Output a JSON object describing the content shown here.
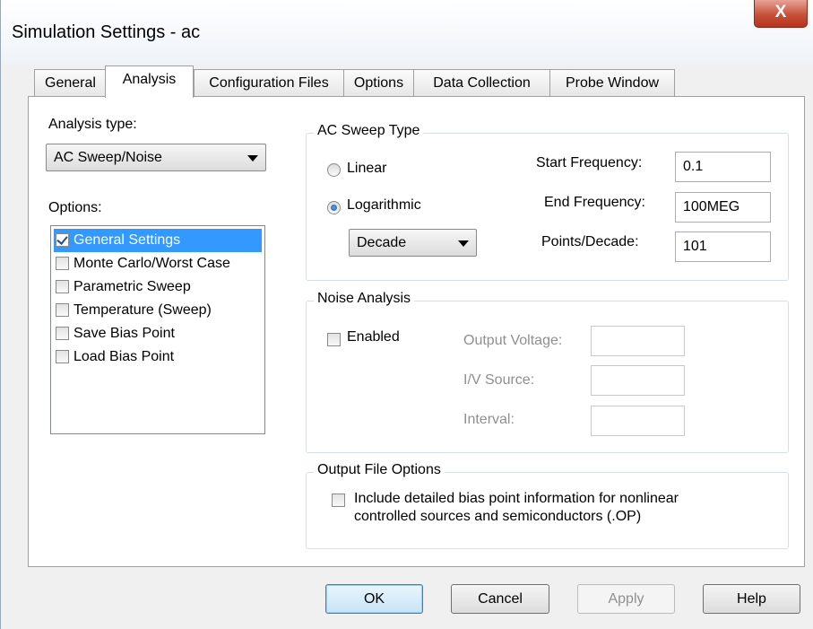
{
  "window": {
    "title": "Simulation Settings - ac",
    "close_label": "X"
  },
  "tabs": [
    {
      "label": "General",
      "active": false
    },
    {
      "label": "Analysis",
      "active": true
    },
    {
      "label": "Configuration Files",
      "active": false
    },
    {
      "label": "Options",
      "active": false
    },
    {
      "label": "Data Collection",
      "active": false
    },
    {
      "label": "Probe Window",
      "active": false
    }
  ],
  "analysis": {
    "type_label": "Analysis type:",
    "type_value": "AC Sweep/Noise",
    "options_label": "Options:",
    "options": [
      {
        "label": "General Settings",
        "checked": true,
        "selected": true
      },
      {
        "label": "Monte Carlo/Worst Case",
        "checked": false,
        "selected": false
      },
      {
        "label": "Parametric Sweep",
        "checked": false,
        "selected": false
      },
      {
        "label": "Temperature (Sweep)",
        "checked": false,
        "selected": false
      },
      {
        "label": "Save Bias Point",
        "checked": false,
        "selected": false
      },
      {
        "label": "Load Bias Point",
        "checked": false,
        "selected": false
      }
    ]
  },
  "sweep": {
    "group_label": "AC Sweep Type",
    "linear_label": "Linear",
    "log_label": "Logarithmic",
    "selected": "Logarithmic",
    "log_mode": "Decade",
    "start_label": "Start Frequency:",
    "start_value": "0.1",
    "end_label": "End Frequency:",
    "end_value": "100MEG",
    "points_label": "Points/Decade:",
    "points_value": "101"
  },
  "noise": {
    "group_label": "Noise Analysis",
    "enabled_label": "Enabled",
    "enabled": false,
    "output_label": "Output Voltage:",
    "output_value": "",
    "source_label": "I/V Source:",
    "source_value": "",
    "interval_label": "Interval:",
    "interval_value": ""
  },
  "output_file": {
    "group_label": "Output File Options",
    "detail_line1": "Include detailed bias point information for nonlinear",
    "detail_line2": "controlled sources and semiconductors (.OP)",
    "checked": false
  },
  "buttons": {
    "ok": "OK",
    "cancel": "Cancel",
    "apply": "Apply",
    "help": "Help"
  }
}
